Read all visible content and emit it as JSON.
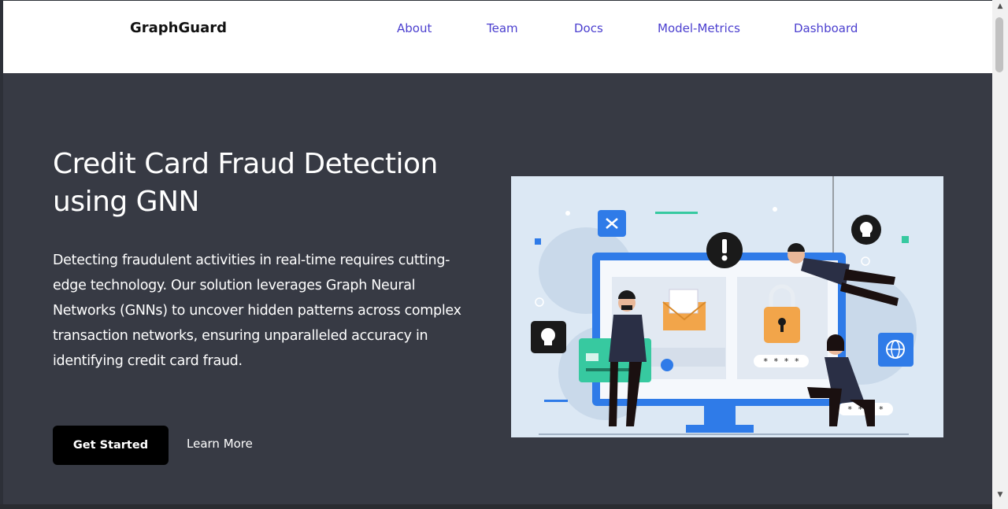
{
  "brand": "GraphGuard",
  "nav": {
    "links": [
      "About",
      "Team",
      "Docs",
      "Model-Metrics",
      "Dashboard"
    ]
  },
  "hero": {
    "title_line1": "Credit Card Fraud Detection",
    "title_line2": "using GNN",
    "description": "Detecting fraudulent activities in real-time requires cutting-edge technology. Our solution leverages Graph Neural Networks (GNNs) to uncover hidden patterns across complex transaction networks, ensuring unparalleled accuracy in identifying credit card fraud.",
    "primary_button": "Get Started",
    "secondary_button": "Learn More"
  },
  "illustration": {
    "password_mask_1": "* * * *",
    "password_mask_2": "* * * *"
  },
  "colors": {
    "nav_link": "#4b3fcf",
    "hero_bg": "#373a44",
    "illustration_bg": "#dce8f4",
    "accent_blue": "#2f7be8",
    "accent_green": "#37c9a0",
    "lock_orange": "#f2a54a"
  },
  "scrollbar": {
    "up_icon": "triangle-up",
    "down_icon": "triangle-down"
  }
}
